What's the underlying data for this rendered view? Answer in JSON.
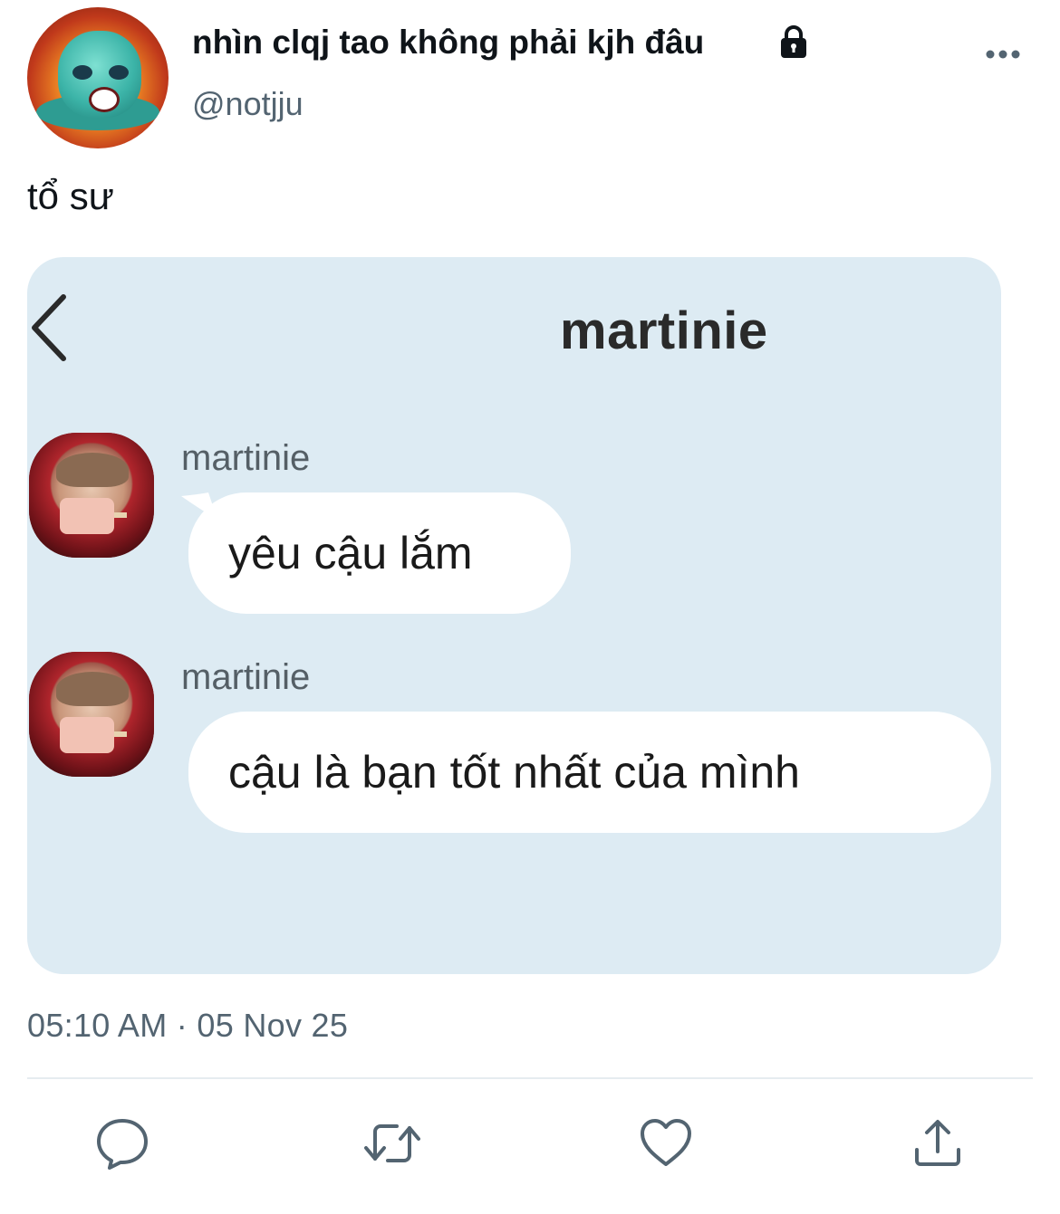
{
  "author": {
    "display_name": "nhìn clqj tao không phải kjh đâu",
    "handle": "@notjju",
    "avatar": "cartoon-monster-in-fire-avatar",
    "protected_icon": "lock-icon",
    "more_icon": "more-horizontal-icon"
  },
  "tweet": {
    "text": "tổ sư",
    "timestamp": "05:10 AM · 05 Nov 25"
  },
  "media": {
    "background_color": "#ddebf3",
    "back_icon": "chevron-left-icon",
    "chat_title": "martinie",
    "messages": [
      {
        "sender": "martinie",
        "text": "yêu cậu lắm"
      },
      {
        "sender": "martinie",
        "text": "cậu là bạn tốt nhất của mình"
      }
    ]
  },
  "actions": [
    "reply-icon",
    "retweet-icon",
    "like-icon",
    "share-icon"
  ],
  "colors": {
    "text_primary": "#0f1419",
    "text_secondary": "#536471",
    "icon": "#536471"
  }
}
